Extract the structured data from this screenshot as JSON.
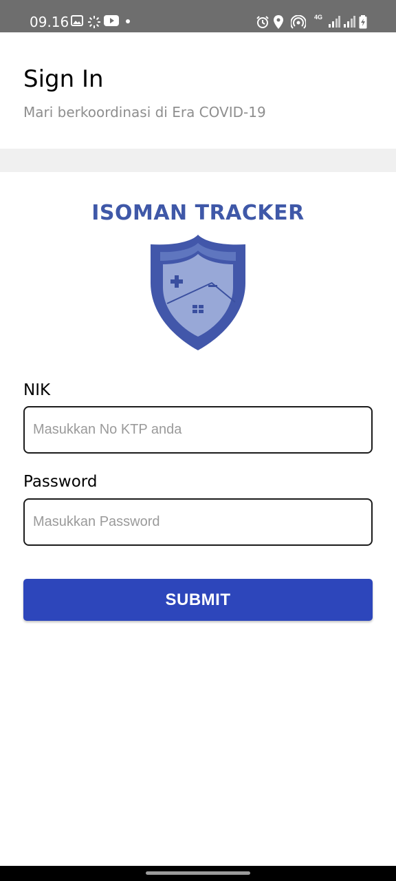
{
  "status_bar": {
    "time": "09.16",
    "network": "4G",
    "left_icons": [
      "gallery-icon",
      "loading-icon",
      "youtube-icon",
      "dot-icon"
    ],
    "right_icons": [
      "alarm-icon",
      "location-icon",
      "hotspot-icon",
      "network-4g-icon",
      "signal-icon",
      "signal-icon",
      "battery-icon"
    ]
  },
  "header": {
    "title": "Sign In",
    "subtitle": "Mari berkoordinasi di Era COVID-19"
  },
  "brand": {
    "name": "ISOMAN TRACKER",
    "logo_icon": "shield-house-icon",
    "color": "#3f58a8"
  },
  "form": {
    "nik_label": "NIK",
    "nik_placeholder": "Masukkan No KTP anda",
    "nik_value": "",
    "password_label": "Password",
    "password_placeholder": "Masukkan Password",
    "password_value": "",
    "submit_label": "SUBMIT",
    "submit_color": "#2d46bb"
  }
}
